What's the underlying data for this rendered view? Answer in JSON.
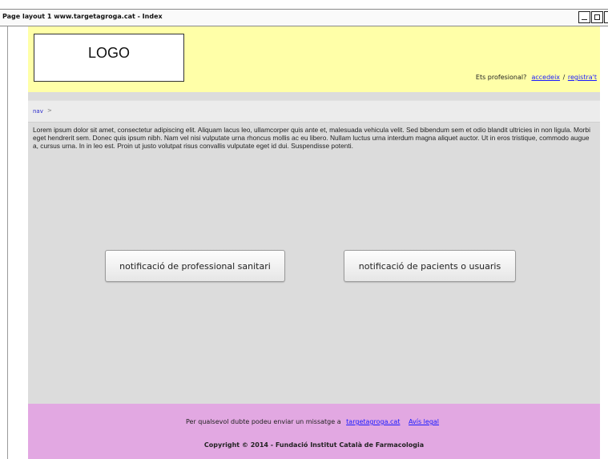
{
  "window": {
    "title": "Page layout 1 www.targetagroga.cat - Index"
  },
  "header": {
    "logo": "LOGO",
    "question": "Ets profesional?",
    "login_link": "accedeix",
    "separator": "/",
    "register_link": "registra't"
  },
  "nav": {
    "label": "nav",
    "arrow": ">"
  },
  "main": {
    "lorem": "Lorem ipsum dolor sit amet, consectetur adipiscing elit. Aliquam lacus leo, ullamcorper quis ante et, malesuada vehicula velit. Sed bibendum sem et odio blandit ultricies in non ligula. Morbi eget hendrerit sem. Donec quis ipsum nibh. Nam vel nisi vulputate urna rhoncus mollis ac eu libero. Nullam luctus urna interdum magna aliquet auctor. Ut in eros tristique, commodo augue a, cursus urna. In in leo est. Proin ut justo volutpat risus convallis vulputate eget id dui. Suspendisse potenti.",
    "button_professional": "notificació de professional sanitari",
    "button_patients": "notificació de pacients o usuaris"
  },
  "footer": {
    "contact_text": "Per qualsevol dubte podeu enviar un missatge a",
    "contact_link": "targetagroga.cat",
    "legal_link": "Avís legal",
    "copyright": "Copyright © 2014  -  Fundació Institut Català de Farmacologia"
  },
  "colors": {
    "header_bg": "#ffffa8",
    "content_bg": "#dcdcdc",
    "footer_bg": "#e2a8e2",
    "link": "#1a1aff"
  }
}
